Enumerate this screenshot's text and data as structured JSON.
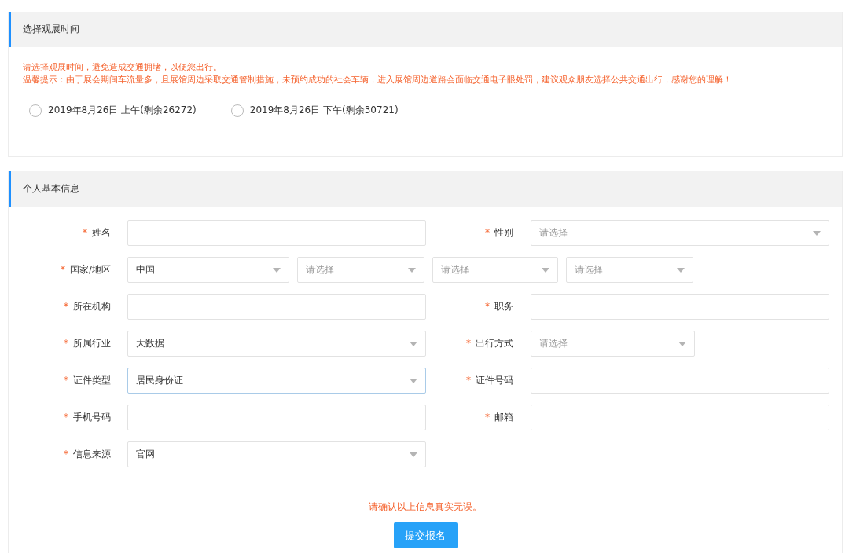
{
  "time_section": {
    "title": "选择观展时间",
    "notices": [
      "请选择观展时间，避免造成交通拥堵，以便您出行。",
      "温馨提示：由于展会期间车流量多，且展馆周边采取交通管制措施，未预约成功的社会车辆，进入展馆周边道路会面临交通电子眼处罚，建议观众朋友选择公共交通出行，感谢您的理解！"
    ],
    "options": [
      {
        "label": "2019年8月26日 上午(剩余26272)",
        "selected": false
      },
      {
        "label": "2019年8月26日 下午(剩余30721)",
        "selected": false
      }
    ]
  },
  "info_section": {
    "title": "个人基本信息",
    "rows": [
      {
        "fields": [
          {
            "kind": "input",
            "mark": "*",
            "label": "姓名",
            "focused": false
          },
          {
            "kind": "select",
            "mark": "*",
            "label": "性别",
            "placeholder": "请选择",
            "focused": false
          }
        ]
      },
      {
        "fields": [
          {
            "kind": "select-group",
            "mark": "*",
            "label": "国家/地区",
            "focused": false,
            "selects": [
              {
                "value": "中国"
              },
              {
                "placeholder": "请选择"
              },
              {
                "placeholder": "请选择"
              },
              {
                "placeholder": "请选择"
              }
            ]
          }
        ]
      },
      {
        "fields": [
          {
            "kind": "input",
            "mark": "*",
            "label": "所在机构",
            "focused": false
          },
          {
            "kind": "input",
            "mark": "*",
            "label": "职务",
            "focused": false
          }
        ]
      },
      {
        "fields": [
          {
            "kind": "select",
            "mark": "*",
            "label": "所属行业",
            "value": "大数据",
            "focused": false
          },
          {
            "kind": "short-select",
            "mark": "*",
            "label": "出行方式",
            "placeholder": "请选择",
            "focused": false
          }
        ]
      },
      {
        "fields": [
          {
            "kind": "select",
            "mark": "*",
            "label": "证件类型",
            "value": "居民身份证",
            "focused": true
          },
          {
            "kind": "input",
            "mark": "*",
            "label": "证件号码",
            "focused": false
          }
        ]
      },
      {
        "fields": [
          {
            "kind": "input",
            "mark": "*",
            "label": "手机号码",
            "focused": false
          },
          {
            "kind": "input",
            "mark": "*",
            "label": "邮箱",
            "focused": false
          }
        ]
      },
      {
        "fields": [
          {
            "kind": "select",
            "mark": "*",
            "label": "信息来源",
            "value": "官网",
            "focused": false
          }
        ]
      }
    ],
    "confirm": "请确认以上信息真实无误。",
    "submit": "提交报名"
  }
}
